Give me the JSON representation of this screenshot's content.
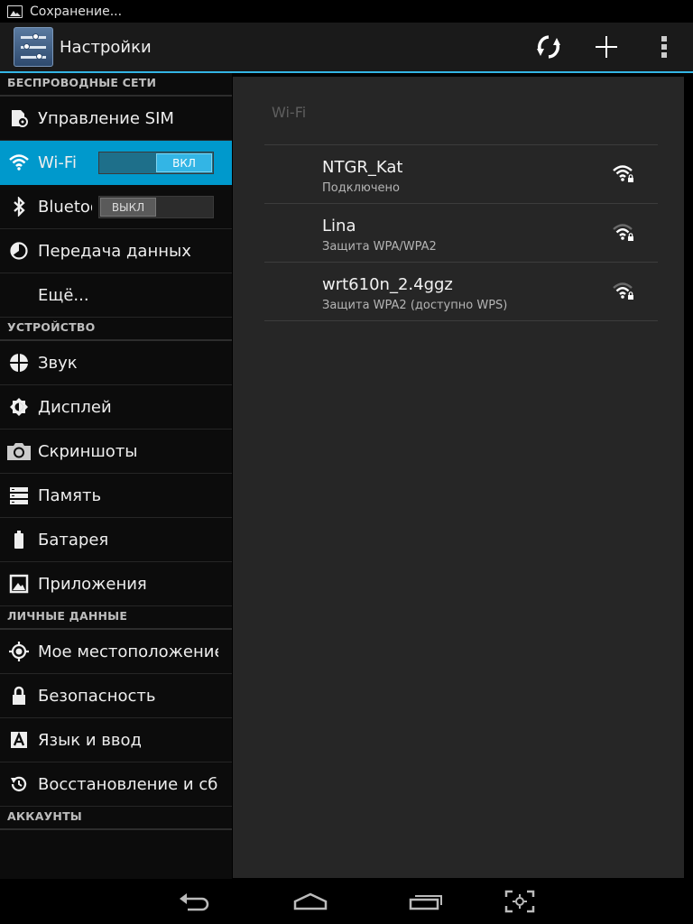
{
  "status_bar": {
    "notification_icon": "picture-icon",
    "text": "Сохранение..."
  },
  "action_bar": {
    "title": "Настройки",
    "app_icon": "settings-sliders-icon",
    "actions": [
      "sync-icon",
      "add-icon",
      "overflow-menu-icon"
    ]
  },
  "sidebar": {
    "sections": [
      {
        "header": "БЕСПРОВОДНЫЕ СЕТИ",
        "items": [
          {
            "label": "Управление SIM",
            "icon": "sim-settings-icon"
          },
          {
            "label": "Wi-Fi",
            "icon": "wifi-icon",
            "selected": true,
            "toggle": "ВКЛ",
            "toggle_state": "on"
          },
          {
            "label": "Bluetooth",
            "icon": "bluetooth-icon",
            "toggle": "ВЫКЛ",
            "toggle_state": "off"
          },
          {
            "label": "Передача данных",
            "icon": "data-usage-icon"
          },
          {
            "label": "Ещё...",
            "icon": ""
          }
        ]
      },
      {
        "header": "УСТРОЙСТВО",
        "items": [
          {
            "label": "Звук",
            "icon": "sound-icon"
          },
          {
            "label": "Дисплей",
            "icon": "display-brightness-icon"
          },
          {
            "label": "Скриншоты",
            "icon": "camera-icon"
          },
          {
            "label": "Память",
            "icon": "storage-icon"
          },
          {
            "label": "Батарея",
            "icon": "battery-icon"
          },
          {
            "label": "Приложения",
            "icon": "apps-icon"
          }
        ]
      },
      {
        "header": "ЛИЧНЫЕ ДАННЫЕ",
        "items": [
          {
            "label": "Мое местоположение",
            "icon": "location-icon"
          },
          {
            "label": "Безопасность",
            "icon": "lock-icon"
          },
          {
            "label": "Язык и ввод",
            "icon": "language-icon"
          },
          {
            "label": "Восстановление и сброс",
            "icon": "backup-restore-icon"
          }
        ]
      },
      {
        "header": "АККАУНТЫ",
        "items": []
      }
    ]
  },
  "wifi_panel": {
    "title": "Wi-Fi",
    "networks": [
      {
        "name": "NTGR_Kat",
        "status": "Подключено",
        "icon": "wifi-signal-locked-icon",
        "signal": 4
      },
      {
        "name": "Lina",
        "status": "Защита WPA/WPA2",
        "icon": "wifi-signal-locked-icon",
        "signal": 3
      },
      {
        "name": "wrt610n_2.4ggz",
        "status": "Защита WPA2 (доступно WPS)",
        "icon": "wifi-signal-locked-icon",
        "signal": 3
      }
    ]
  },
  "watermark": {
    "icon": "mobile-review-logo"
  },
  "nav_bar": {
    "buttons": [
      "back-icon",
      "home-icon",
      "recent-apps-icon",
      "screenshot-icon"
    ]
  },
  "colors": {
    "accent": "#33b5e5",
    "selected": "#0099cc",
    "panel": "#262626"
  }
}
